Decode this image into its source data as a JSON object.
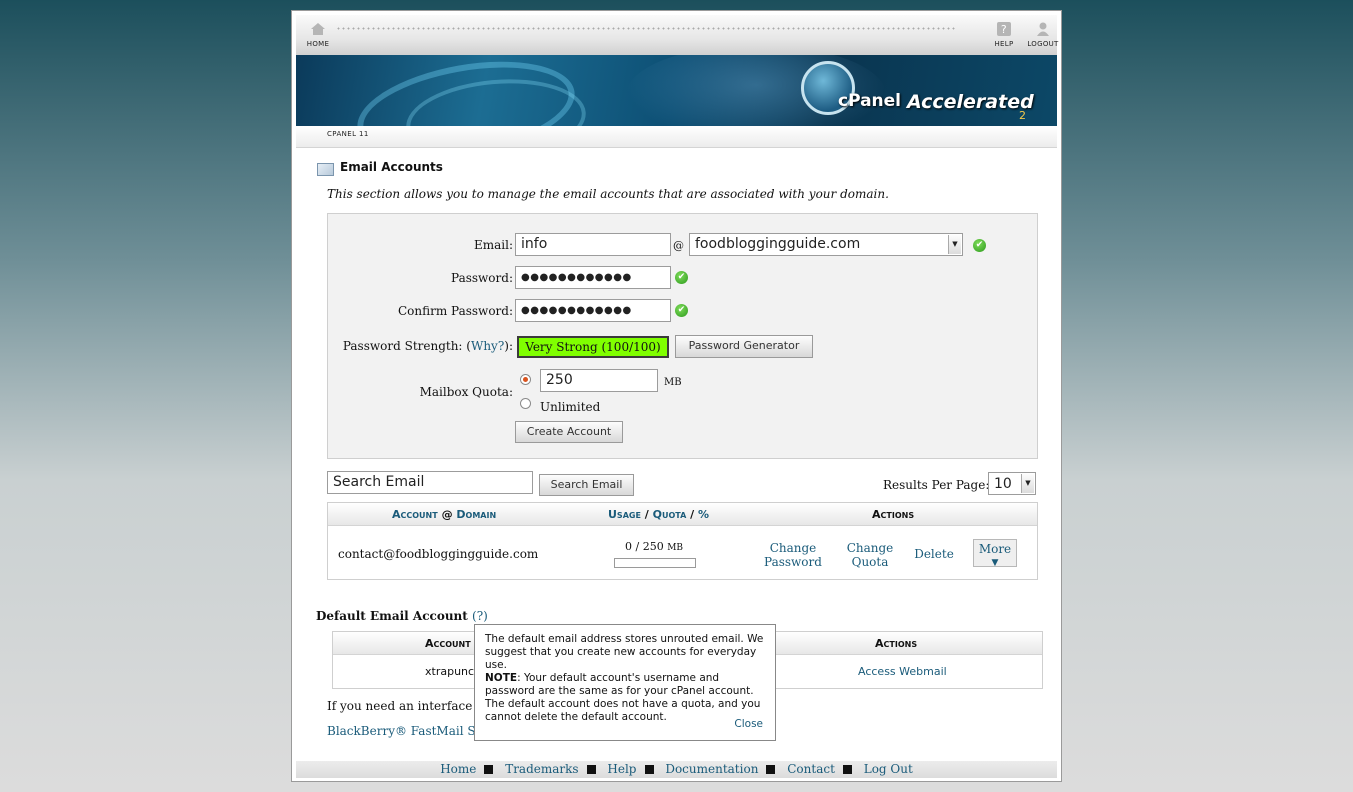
{
  "topbar": {
    "home_label": "HOME",
    "help_label": "HELP",
    "logout_label": "LOGOUT"
  },
  "banner": {
    "logo_name": "cPanel",
    "logo_product": "Accelerated",
    "logo_version": "2"
  },
  "breadcrumb": "CPANEL 11",
  "page": {
    "title": "Email Accounts",
    "description": "This section allows you to manage the email accounts that are associated with your domain."
  },
  "form": {
    "email_label": "Email:",
    "email_value": "info",
    "at_symbol": "@",
    "domain_value": "foodbloggingguide.com",
    "password_label": "Password:",
    "password_value": "●●●●●●●●●●●●",
    "confirm_label": "Confirm Password:",
    "confirm_value": "●●●●●●●●●●●●",
    "strength_label": "Password Strength: (",
    "strength_why": "Why?",
    "strength_suffix": "):",
    "strength_value": "Very Strong (100/100)",
    "generator_button": "Password Generator",
    "quota_label": "Mailbox Quota:",
    "quota_value": "250",
    "quota_unit": "MB",
    "unlimited_label": "Unlimited",
    "create_button": "Create Account"
  },
  "search": {
    "value": "Search Email",
    "button": "Search Email",
    "results_label": "Results Per Page:",
    "results_value": "10"
  },
  "accounts_table": {
    "headers": {
      "account": "Account",
      "at": "@",
      "domain": "Domain",
      "usage": "Usage",
      "slash1": "/",
      "quota": "Quota",
      "slash2": "/",
      "percent": "%",
      "actions": "Actions"
    },
    "rows": [
      {
        "account": "contact@foodbloggingguide.com",
        "usage": "0 / 250",
        "unit": "MB",
        "usage_fraction": 0,
        "change_password_1": "Change",
        "change_password_2": "Password",
        "change_quota_1": "Change",
        "change_quota_2": "Quota",
        "delete": "Delete",
        "more": "More",
        "more_arrow": "▼"
      }
    ]
  },
  "default_account": {
    "title": "Default Email Account",
    "help": "(?)",
    "header_account": "Account",
    "header_actions": "Actions",
    "account_value": "xtrapunch",
    "action": "Access Webmail"
  },
  "interface_note": "If you need an interface th",
  "blackberry_link": "BlackBerry® FastMail Se",
  "tooltip": {
    "text1": "The default email address stores unrouted email. We suggest that you create new accounts for everyday use.",
    "note_label": "NOTE",
    "text2": ": Your default account's username and password are the same as for your cPanel account. The default account does not have a quota, and you cannot delete the default account.",
    "close": "Close"
  },
  "footer": {
    "links": [
      "Home",
      "Trademarks",
      "Help",
      "Documentation",
      "Contact",
      "Log Out"
    ]
  },
  "colors": {
    "link": "#1a5b7a",
    "strength_bg": "#80ff00",
    "ok_green": "#2c9a1d",
    "radio_selected": "#d9531e"
  }
}
